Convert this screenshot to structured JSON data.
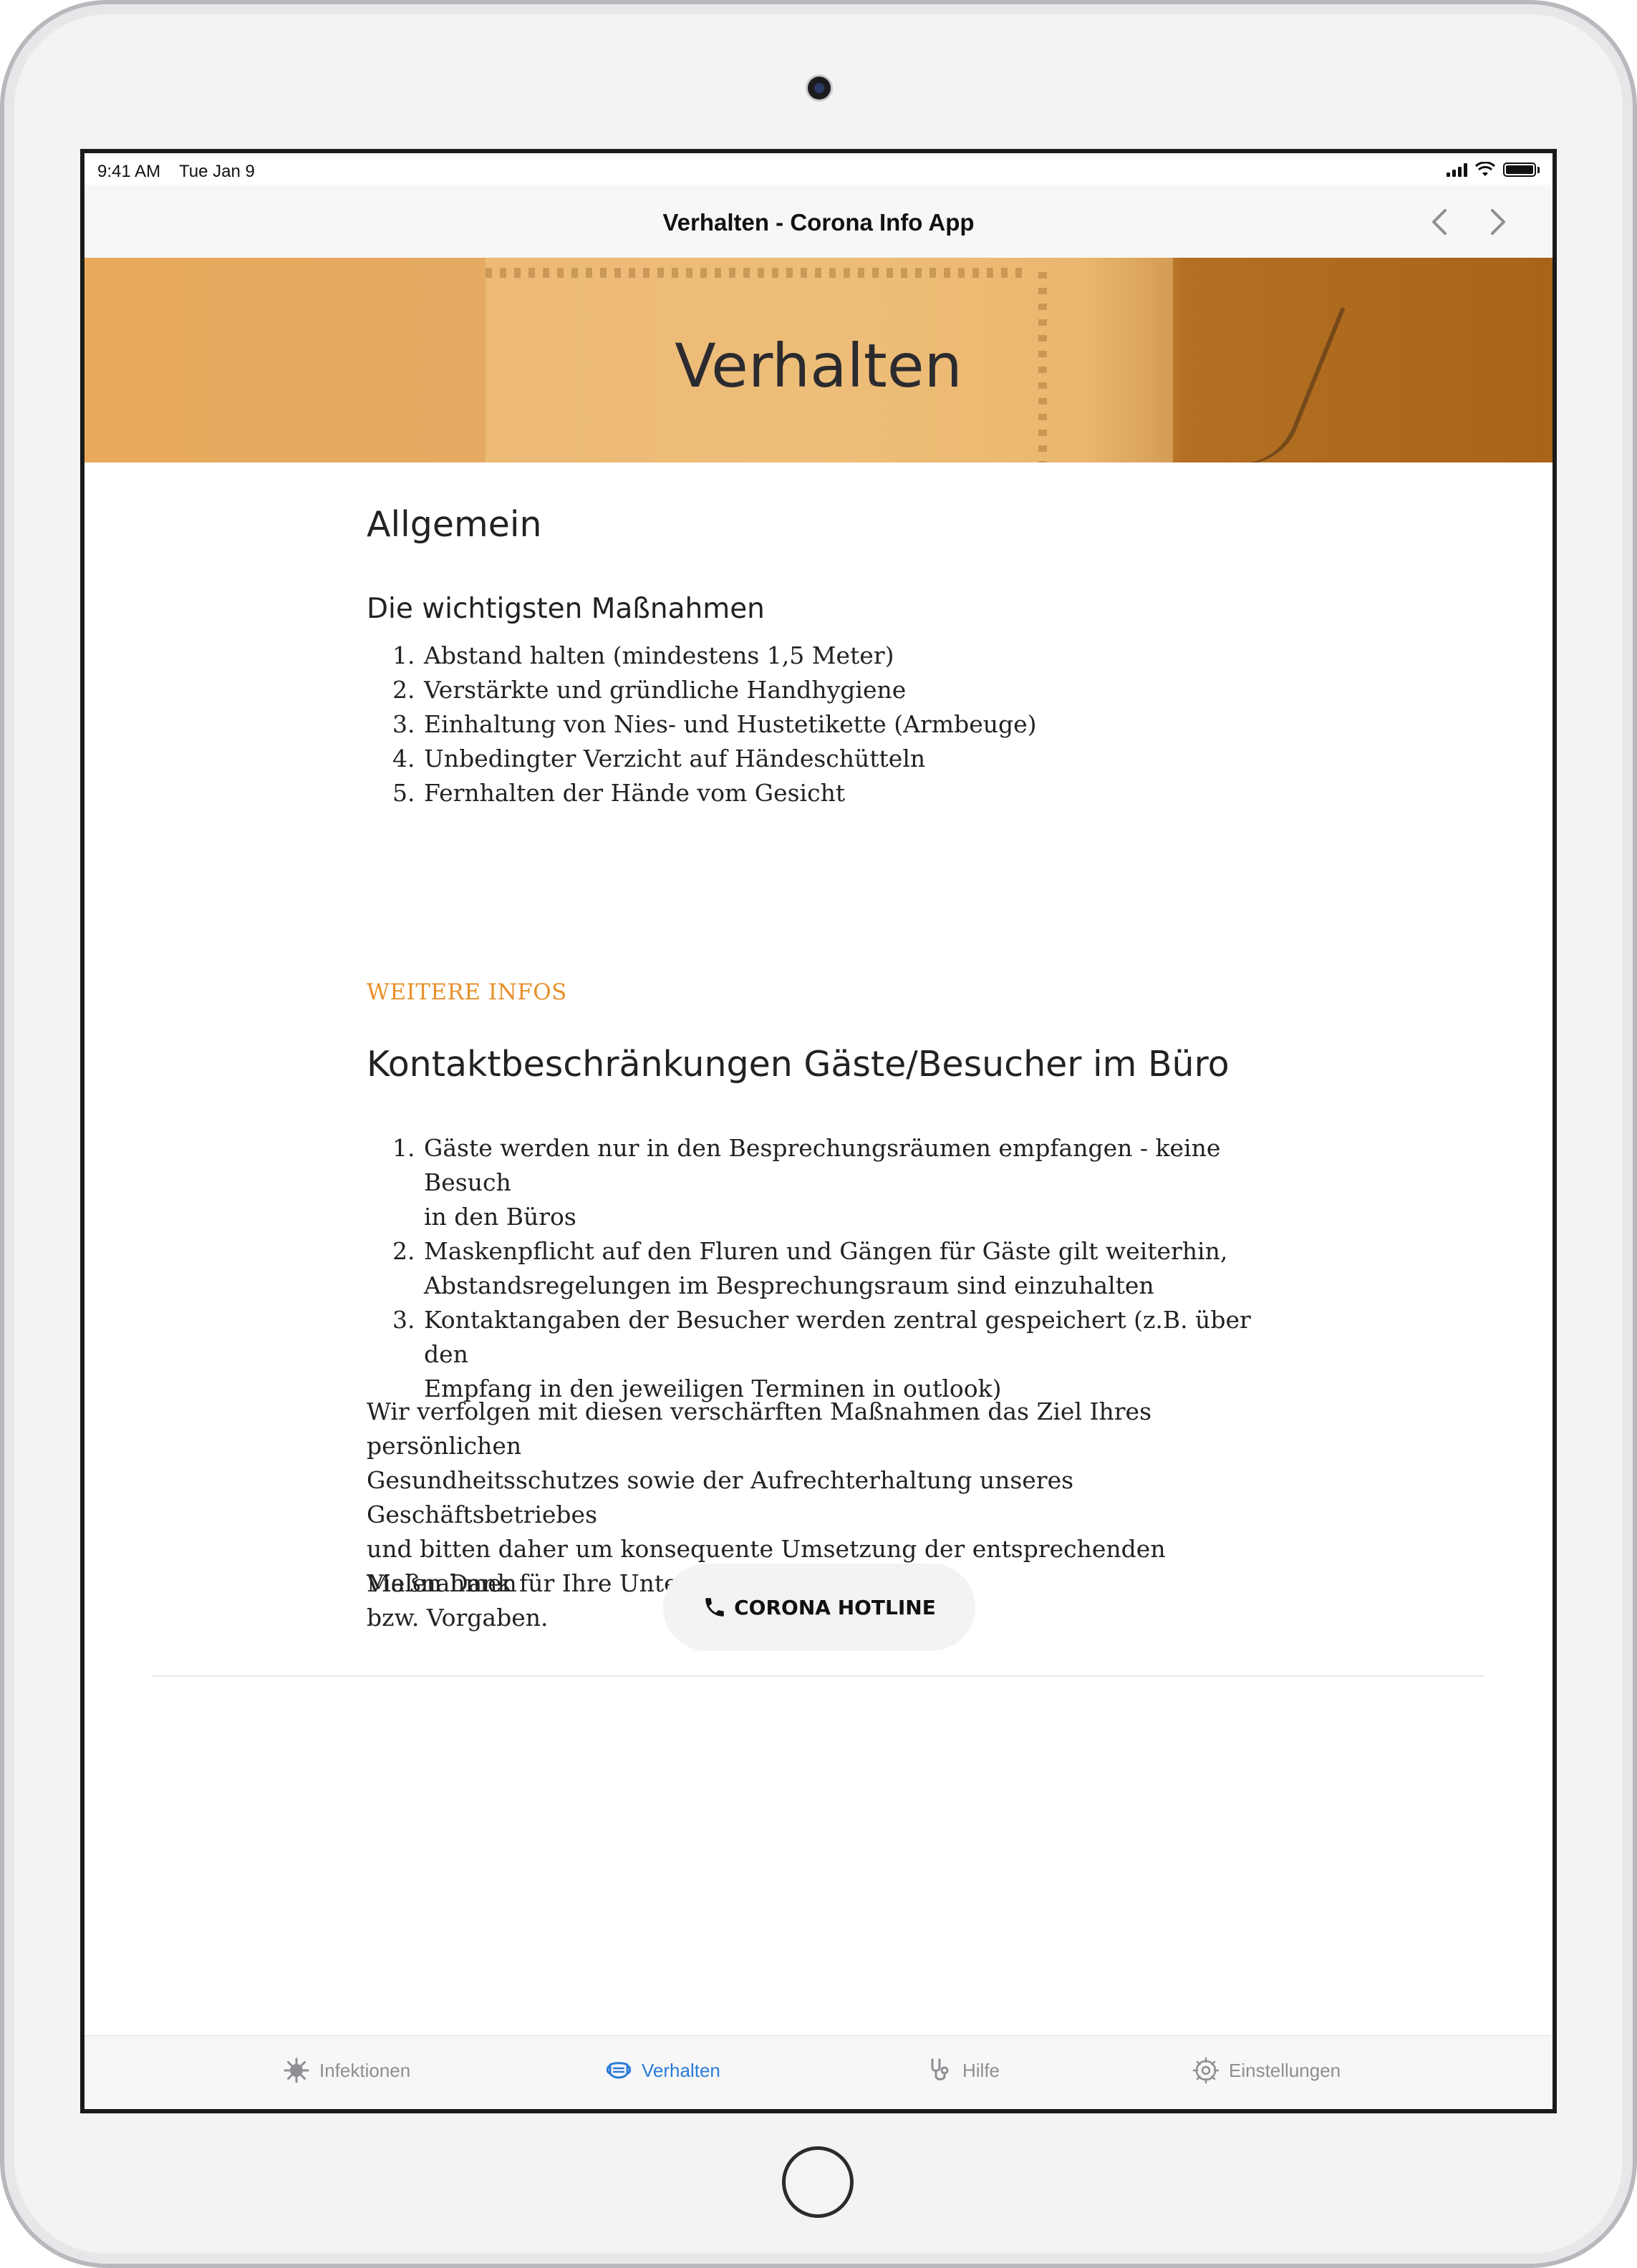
{
  "status_bar": {
    "time": "9:41 AM",
    "date": "Tue Jan 9"
  },
  "nav": {
    "title": "Verhalten - Corona Info App",
    "back_icon": "chevron-left-icon",
    "forward_icon": "chevron-right-icon"
  },
  "hero": {
    "title": "Verhalten"
  },
  "section1": {
    "title": "Allgemein",
    "subtitle": "Die wichtigsten Maßnahmen",
    "items": [
      "Abstand halten (mindestens 1,5 Meter)",
      "Verstärkte und gründliche Handhygiene",
      "Einhaltung von Nies- und Hustetikette (Armbeuge)",
      "Unbedingter Verzicht auf Händeschütteln",
      "Fernhalten der Hände vom Gesicht"
    ],
    "link": "WEITERE INFOS"
  },
  "section2": {
    "title": "Kontaktbeschränkungen Gäste/Besucher im Büro",
    "items": [
      {
        "line1": "Gäste werden nur in den Besprechungsräumen empfangen - keine Besuch",
        "line2": "in den Büros"
      },
      {
        "line1": "Maskenpflicht auf den Fluren und Gängen für Gäste gilt weiterhin,",
        "line2": "Abstandsregelungen im Besprechungsraum sind einzuhalten"
      },
      {
        "line1": "Kontaktangaben der Besucher werden zentral gespeichert (z.B. über den",
        "line2": "Empfang in den jeweiligen Terminen in outlook)"
      }
    ],
    "paragraph": [
      "Wir verfolgen mit diesen verschärften Maßnahmen das Ziel Ihres persönlichen",
      "Gesundheitsschutzes sowie der Aufrechterhaltung unseres Geschäftsbetriebes",
      "und bitten daher um konsequente Umsetzung der entsprechenden Maßnahmen",
      "bzw. Vorgaben."
    ],
    "thanks": "Vielen Dank für Ihre Unterstützung."
  },
  "hotline": {
    "label": "CORONA HOTLINE",
    "icon": "phone-icon"
  },
  "tabs": [
    {
      "label": "Infektionen",
      "icon": "virus-icon",
      "active": false
    },
    {
      "label": "Verhalten",
      "icon": "mask-icon",
      "active": true
    },
    {
      "label": "Hilfe",
      "icon": "stethoscope-icon",
      "active": false
    },
    {
      "label": "Einstellungen",
      "icon": "gear-icon",
      "active": false
    }
  ],
  "colors": {
    "accent_link": "#e8902a",
    "tab_active": "#2a7bd6",
    "tab_inactive": "#8e8e93",
    "hero_orange": "#e8a95b"
  }
}
